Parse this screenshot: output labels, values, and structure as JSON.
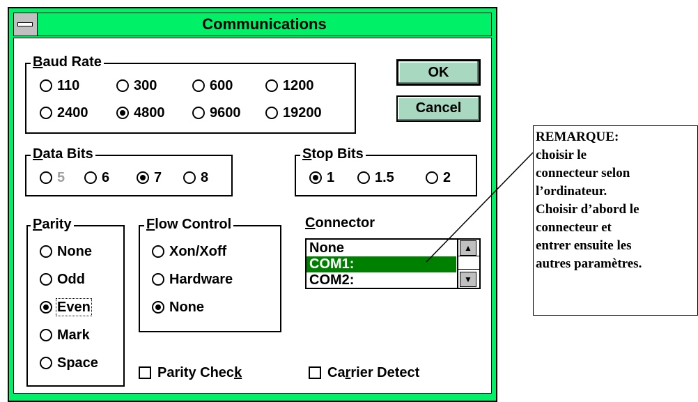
{
  "window": {
    "title": "Communications",
    "system_menu_icon": "minus-bar"
  },
  "buttons": {
    "ok": "OK",
    "cancel": "Cancel"
  },
  "baud_rate": {
    "label_mnemonic": "B",
    "label_rest": "aud Rate",
    "options": [
      "110",
      "300",
      "600",
      "1200",
      "2400",
      "4800",
      "9600",
      "19200"
    ],
    "selected": "4800"
  },
  "data_bits": {
    "label_mnemonic": "D",
    "label_rest": "ata Bits",
    "options": [
      "5",
      "6",
      "7",
      "8"
    ],
    "selected": "7",
    "disabled": [
      "5"
    ]
  },
  "stop_bits": {
    "label_mnemonic": "S",
    "label_rest": "top Bits",
    "options": [
      "1",
      "1.5",
      "2"
    ],
    "selected": "1"
  },
  "parity": {
    "label_mnemonic": "P",
    "label_rest": "arity",
    "options": [
      "None",
      "Odd",
      "Even",
      "Mark",
      "Space"
    ],
    "selected": "Even"
  },
  "flow_control": {
    "label_mnemonic": "F",
    "label_rest": "low Control",
    "options": [
      "Xon/Xoff",
      "Hardware",
      "None"
    ],
    "selected": "None"
  },
  "connector": {
    "label_mnemonic": "C",
    "label_rest": "onnector",
    "items": [
      "None",
      "COM1:",
      "COM2:"
    ],
    "selected": "COM1:",
    "scroll_up_icon": "up-arrow",
    "scroll_down_icon": "down-arrow"
  },
  "checkboxes": {
    "parity_check_before": "Parity Chec",
    "parity_check_mnemonic": "k",
    "carrier_detect_before": "Ca",
    "carrier_detect_mnemonic": "r",
    "carrier_detect_after": "rier Detect"
  },
  "note": {
    "lines": [
      "REMARQUE:",
      "choisir le",
      "connecteur selon",
      "l’ordinateur.",
      "Choisir d’abord le",
      "connecteur et",
      "entrer ensuite les",
      "autres paramètres."
    ]
  },
  "colors": {
    "frame": "#00f068",
    "selection": "#008000",
    "button_face": "#a8d8c0"
  }
}
